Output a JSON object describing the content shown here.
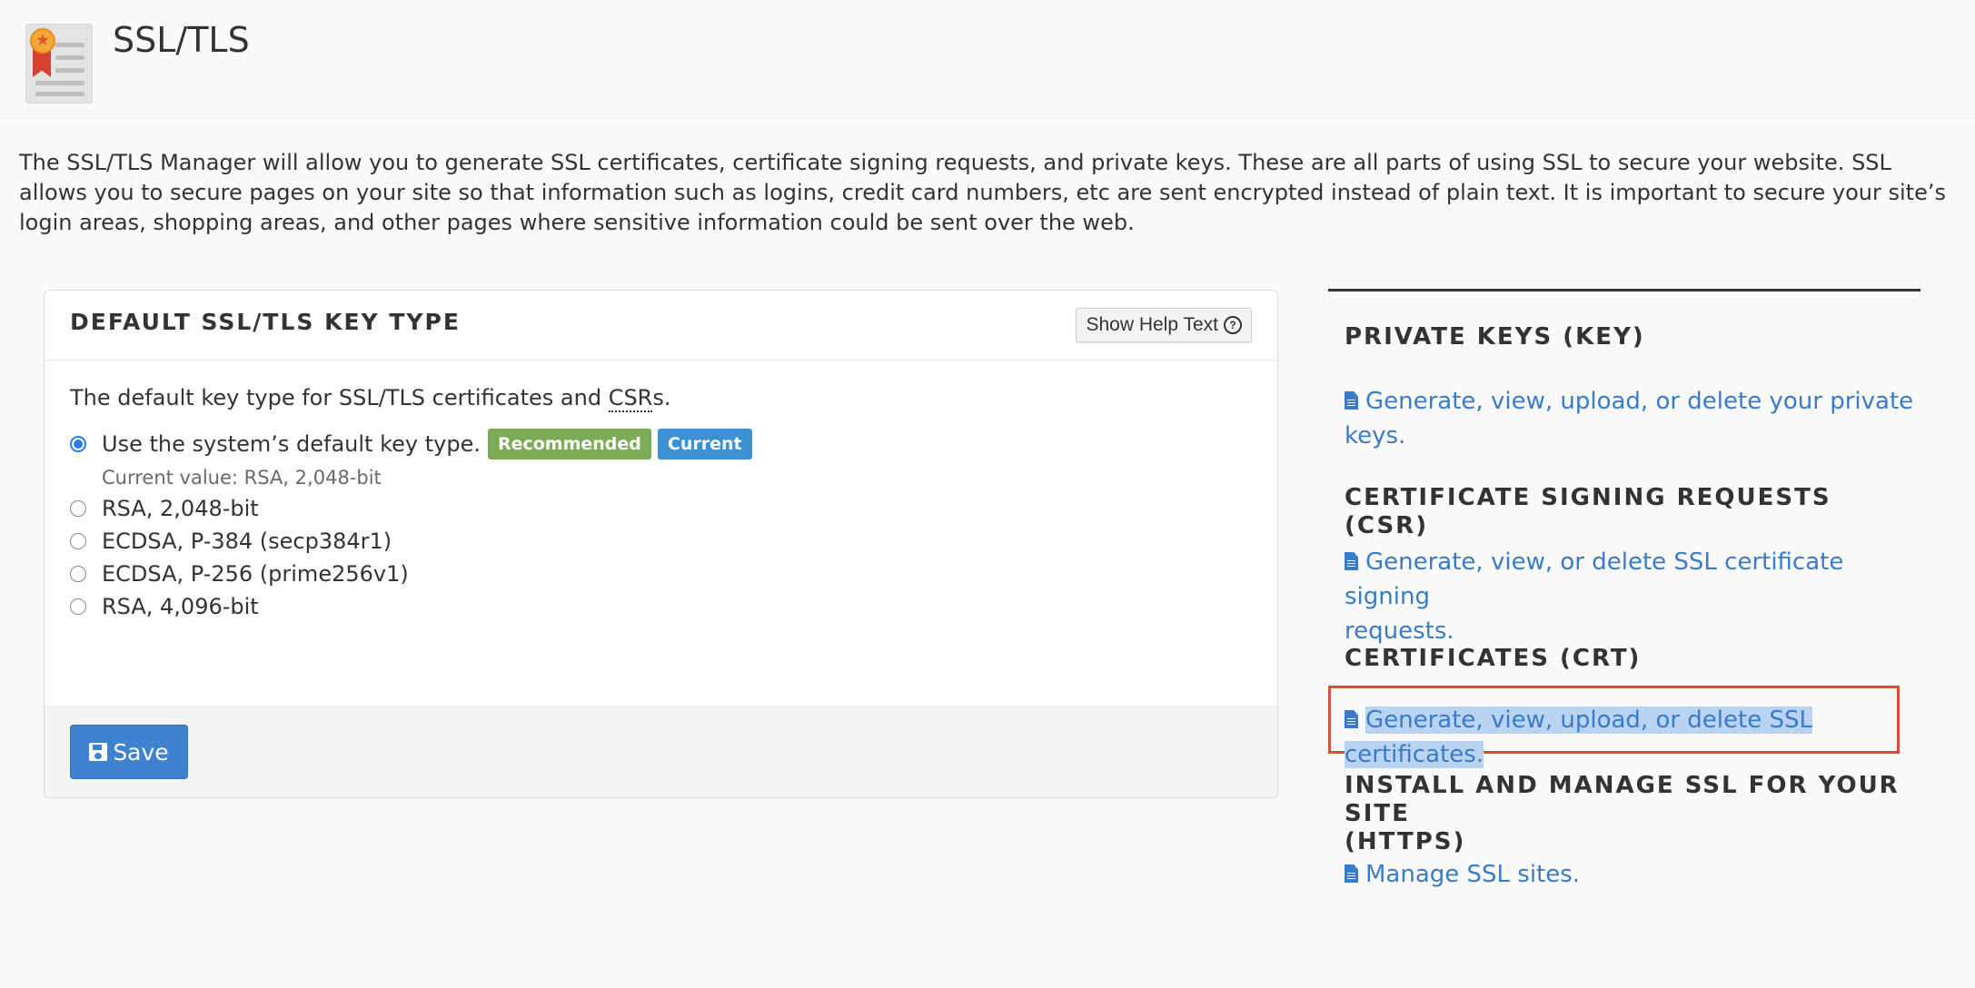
{
  "header": {
    "title": "SSL/TLS",
    "icon": "certificate-icon"
  },
  "intro": {
    "text": "The SSL/TLS Manager will allow you to generate SSL certificates, certificate signing requests, and private keys. These are all parts of using SSL to secure your website. SSL allows you to secure pages on your site so that information such as logins, credit card numbers, etc are sent encrypted instead of plain text. It is important to secure your site’s login areas, shopping areas, and other pages where sensitive information could be sent over the web."
  },
  "key_type_panel": {
    "title": "DEFAULT SSL/TLS KEY TYPE",
    "help_button": "Show Help Text",
    "help_icon": "question-circle-icon",
    "description_prefix": "The default key type for SSL/TLS certificates and ",
    "description_abbr": "CSR",
    "description_suffix": "s.",
    "options": [
      {
        "label": "Use the system’s default key type.",
        "checked": true
      },
      {
        "label": "RSA, 2,048-bit",
        "checked": false
      },
      {
        "label": "ECDSA, P-384 (secp384r1)",
        "checked": false
      },
      {
        "label": "ECDSA, P-256 (prime256v1)",
        "checked": false
      },
      {
        "label": "RSA, 4,096-bit",
        "checked": false
      }
    ],
    "badges": {
      "recommended": "Recommended",
      "current": "Current"
    },
    "current_value": "Current value: RSA, 2,048-bit",
    "save_label": "Save",
    "save_icon": "floppy-disk-icon"
  },
  "sidebar": {
    "sections": [
      {
        "heading": "PRIVATE KEYS (KEY)",
        "link_line1": "Generate, view, upload, or delete your private",
        "link_line2": "keys."
      },
      {
        "heading": "CERTIFICATE SIGNING REQUESTS (CSR)",
        "link_line1": "Generate, view, or delete SSL certificate signing",
        "link_line2": "requests."
      },
      {
        "heading": "CERTIFICATES (CRT)",
        "link_line1": "Generate, view, upload, or delete SSL certificates."
      },
      {
        "heading_line1": "INSTALL AND MANAGE SSL FOR YOUR SITE",
        "heading_line2": "(HTTPS)",
        "link_line1": "Manage SSL sites."
      }
    ],
    "link_icon": "document-icon"
  },
  "colors": {
    "link": "#3a7bc8",
    "primary_button": "#3f82d0",
    "badge_recommended": "#7daa57",
    "badge_current": "#3b91d1",
    "highlight_border": "#e14b36",
    "text_selection": "#b9d4f3"
  }
}
